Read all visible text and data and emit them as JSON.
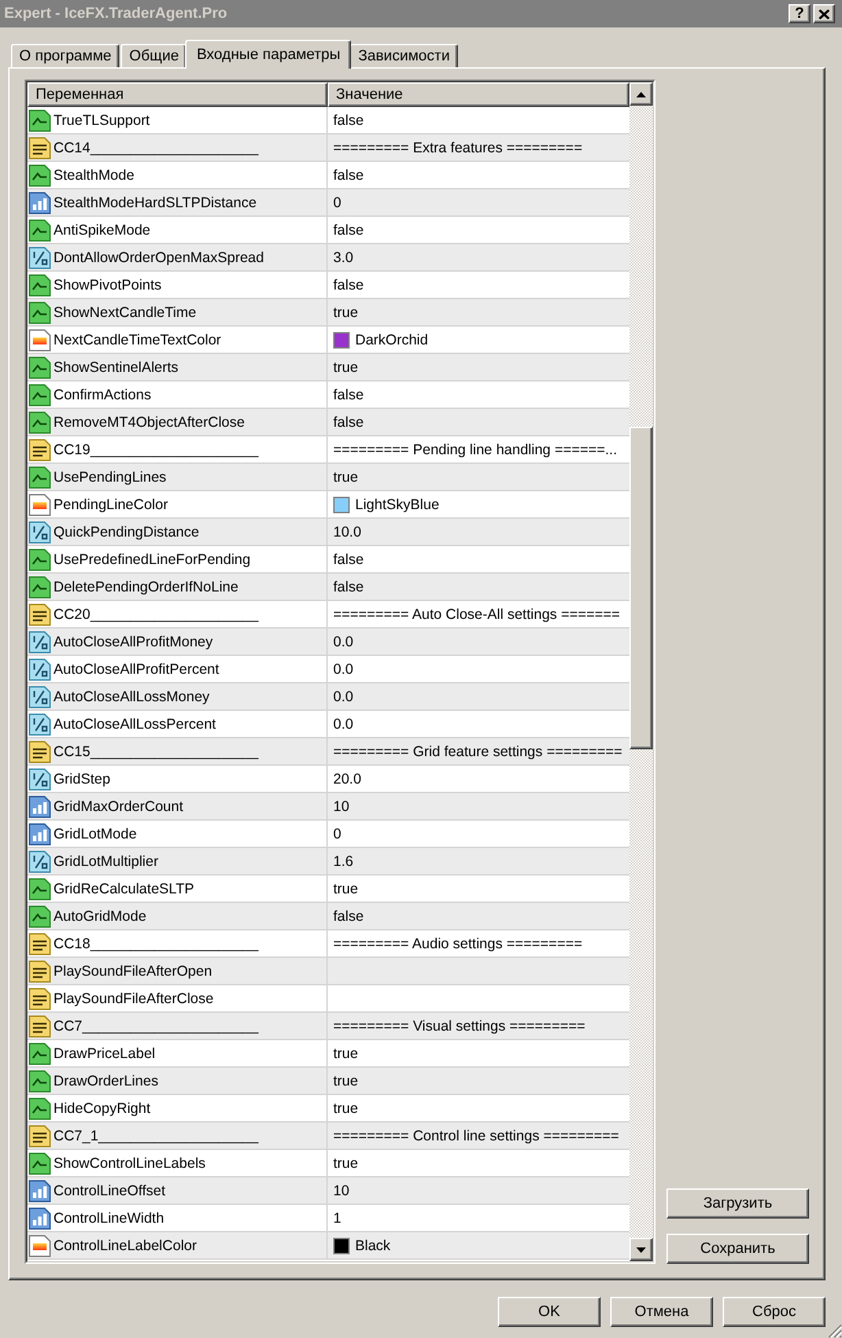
{
  "window": {
    "title": "Expert - IceFX.TraderAgent.Pro",
    "help_button": "?"
  },
  "tabs": [
    {
      "label": "О программе",
      "selected": false
    },
    {
      "label": "Общие",
      "selected": false
    },
    {
      "label": "Входные параметры",
      "selected": true
    },
    {
      "label": "Зависимости",
      "selected": false
    }
  ],
  "table": {
    "columns": [
      "Переменная",
      "Значение"
    ],
    "rows": [
      {
        "kind": "bool",
        "name": "TrueTLSupport",
        "value": "false"
      },
      {
        "kind": "string",
        "name": "CC14_____________________",
        "value": "========= Extra features ========="
      },
      {
        "kind": "bool",
        "name": "StealthMode",
        "value": "false"
      },
      {
        "kind": "int",
        "name": "StealthModeHardSLTPDistance",
        "value": "0"
      },
      {
        "kind": "bool",
        "name": "AntiSpikeMode",
        "value": "false"
      },
      {
        "kind": "double",
        "name": "DontAllowOrderOpenMaxSpread",
        "value": "3.0"
      },
      {
        "kind": "bool",
        "name": "ShowPivotPoints",
        "value": "false"
      },
      {
        "kind": "bool",
        "name": "ShowNextCandleTime",
        "value": "true"
      },
      {
        "kind": "color",
        "name": "NextCandleTimeTextColor",
        "value": "DarkOrchid",
        "color": "#9932cc"
      },
      {
        "kind": "bool",
        "name": "ShowSentinelAlerts",
        "value": "true"
      },
      {
        "kind": "bool",
        "name": "ConfirmActions",
        "value": "false"
      },
      {
        "kind": "bool",
        "name": "RemoveMT4ObjectAfterClose",
        "value": "false"
      },
      {
        "kind": "string",
        "name": "CC19_____________________",
        "value": "========= Pending line handling ======..."
      },
      {
        "kind": "bool",
        "name": "UsePendingLines",
        "value": "true"
      },
      {
        "kind": "color",
        "name": "PendingLineColor",
        "value": "LightSkyBlue",
        "color": "#87cefa"
      },
      {
        "kind": "double",
        "name": "QuickPendingDistance",
        "value": "10.0"
      },
      {
        "kind": "bool",
        "name": "UsePredefinedLineForPending",
        "value": "false"
      },
      {
        "kind": "bool",
        "name": "DeletePendingOrderIfNoLine",
        "value": "false"
      },
      {
        "kind": "string",
        "name": "CC20_____________________",
        "value": "========= Auto Close-All settings ======="
      },
      {
        "kind": "double",
        "name": "AutoCloseAllProfitMoney",
        "value": "0.0"
      },
      {
        "kind": "double",
        "name": "AutoCloseAllProfitPercent",
        "value": "0.0"
      },
      {
        "kind": "double",
        "name": "AutoCloseAllLossMoney",
        "value": "0.0"
      },
      {
        "kind": "double",
        "name": "AutoCloseAllLossPercent",
        "value": "0.0"
      },
      {
        "kind": "string",
        "name": "CC15_____________________",
        "value": "========= Grid feature settings ========="
      },
      {
        "kind": "double",
        "name": "GridStep",
        "value": "20.0"
      },
      {
        "kind": "int",
        "name": "GridMaxOrderCount",
        "value": "10"
      },
      {
        "kind": "int",
        "name": "GridLotMode",
        "value": "0"
      },
      {
        "kind": "double",
        "name": "GridLotMultiplier",
        "value": "1.6"
      },
      {
        "kind": "bool",
        "name": "GridReCalculateSLTP",
        "value": "true"
      },
      {
        "kind": "bool",
        "name": "AutoGridMode",
        "value": "false"
      },
      {
        "kind": "string",
        "name": "CC18_____________________",
        "value": "========= Audio settings ========="
      },
      {
        "kind": "string",
        "name": "PlaySoundFileAfterOpen"
      },
      {
        "kind": "string",
        "name": "PlaySoundFileAfterClose"
      },
      {
        "kind": "string",
        "name": "CC7______________________",
        "value": "========= Visual settings ========="
      },
      {
        "kind": "bool",
        "name": "DrawPriceLabel",
        "value": "true"
      },
      {
        "kind": "bool",
        "name": "DrawOrderLines",
        "value": "true"
      },
      {
        "kind": "bool",
        "name": "HideCopyRight",
        "value": "true"
      },
      {
        "kind": "string",
        "name": "CC7_1____________________",
        "value": "========= Control line settings ========="
      },
      {
        "kind": "bool",
        "name": "ShowControlLineLabels",
        "value": "true"
      },
      {
        "kind": "int",
        "name": "ControlLineOffset",
        "value": "10"
      },
      {
        "kind": "int",
        "name": "ControlLineWidth",
        "value": "1"
      },
      {
        "kind": "color",
        "name": "ControlLineLabelColor",
        "value": "Black",
        "color": "#000000"
      }
    ]
  },
  "side_buttons": [
    "Загрузить",
    "Сохранить"
  ],
  "buttons": [
    "OK",
    "Отмена",
    "Сброс"
  ]
}
